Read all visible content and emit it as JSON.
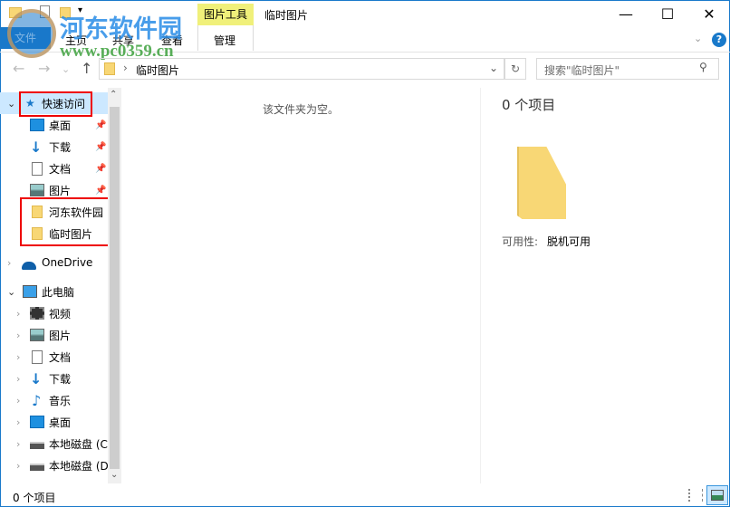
{
  "window": {
    "title": "临时图片",
    "context_tab": "图片工具",
    "minimize": "—",
    "maximize": "☐",
    "close": "✕"
  },
  "ribbon": {
    "tabs": [
      "文件",
      "主页",
      "共享",
      "查看",
      "管理"
    ]
  },
  "watermark": {
    "name": "河东软件园",
    "url": "www.pc0359.cn"
  },
  "address": {
    "path": "临时图片",
    "search_placeholder": "搜索\"临时图片\""
  },
  "nav": {
    "quick_access": "快速访问",
    "quick_items": [
      {
        "label": "桌面",
        "icon": "desktop-icon",
        "pinned": true
      },
      {
        "label": "下载",
        "icon": "download-icon",
        "pinned": true
      },
      {
        "label": "文档",
        "icon": "document-icon",
        "pinned": true
      },
      {
        "label": "图片",
        "icon": "pictures-icon",
        "pinned": true
      },
      {
        "label": "河东软件园",
        "icon": "folder-icon",
        "pinned": false
      },
      {
        "label": "临时图片",
        "icon": "folder-icon",
        "pinned": false
      }
    ],
    "onedrive": "OneDrive",
    "this_pc": "此电脑",
    "pc_items": [
      {
        "label": "视频",
        "icon": "video-icon"
      },
      {
        "label": "图片",
        "icon": "pictures-icon"
      },
      {
        "label": "文档",
        "icon": "document-icon"
      },
      {
        "label": "下载",
        "icon": "download-icon"
      },
      {
        "label": "音乐",
        "icon": "music-icon"
      },
      {
        "label": "桌面",
        "icon": "desktop-icon"
      },
      {
        "label": "本地磁盘 (C",
        "icon": "drive-icon"
      },
      {
        "label": "本地磁盘 (D",
        "icon": "drive-icon"
      }
    ]
  },
  "content": {
    "empty_text": "该文件夹为空。"
  },
  "preview": {
    "count": "0 个项目",
    "availability_label": "可用性:",
    "availability_value": "脱机可用"
  },
  "status": {
    "count": "0 个项目"
  },
  "colors": {
    "accent": "#1979ca",
    "highlight": "#cce8ff",
    "context_tab": "#f0f07a",
    "annotation": "#e00000"
  }
}
